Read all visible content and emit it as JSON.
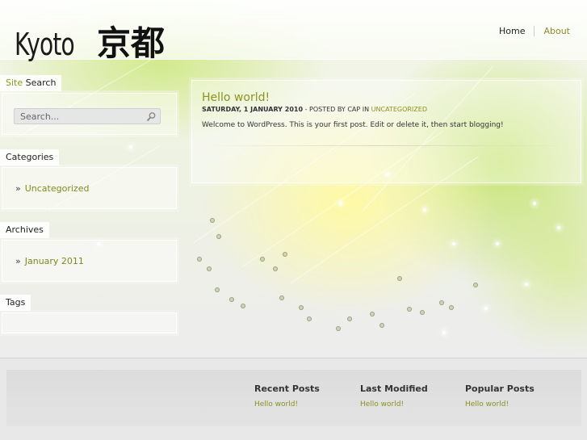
{
  "header": {
    "logo_latin": "Kyoto",
    "logo_kanji": "京都",
    "nav": [
      {
        "label": "Home"
      },
      {
        "label": "About"
      }
    ]
  },
  "sidebar": {
    "search": {
      "title_accent": "Site",
      "title_rest": " Search",
      "placeholder": "Search..."
    },
    "categories": {
      "title": "Categories",
      "items": [
        {
          "label": "Uncategorized"
        }
      ]
    },
    "archives": {
      "title": "Archives",
      "items": [
        {
          "label": "January 2011"
        }
      ]
    },
    "tags": {
      "title": "Tags"
    },
    "bullet": "»"
  },
  "post": {
    "title": "Hello world!",
    "date": "Saturday, 1 January 2010",
    "posted_by": " - Posted by ",
    "author": "cap",
    "in_label": " in ",
    "category": "Uncategorized",
    "body": "Welcome to WordPress. This is your first post. Edit or delete it, then start blogging!"
  },
  "footer": {
    "columns": [
      {
        "heading": "Recent Posts",
        "link": "Hello world!"
      },
      {
        "heading": "Last Modified",
        "link": "Hello world!"
      },
      {
        "heading": "Popular Posts",
        "link": "Hello world!"
      }
    ]
  },
  "colors": {
    "accent_link": "#8a9222",
    "logo": "#111111"
  }
}
